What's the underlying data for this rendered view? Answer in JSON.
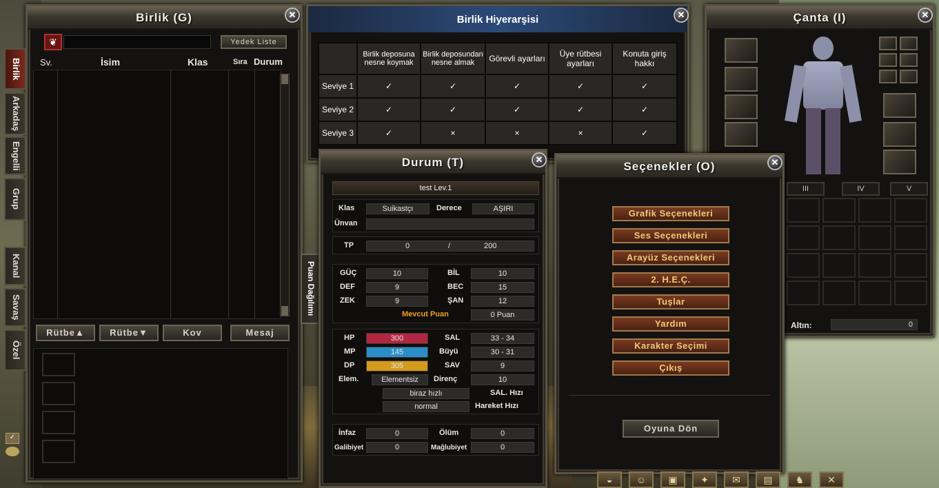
{
  "birlik": {
    "title": "Birlik (G)",
    "reserve_button": "Yedek Liste",
    "columns": [
      "Sv.",
      "İsim",
      "Klas",
      "Sıra",
      "Durum"
    ],
    "buttons": [
      "Rütbe▲",
      "Rütbe▼",
      "Kov",
      "Mesaj"
    ],
    "tabs": [
      "Birlik",
      "Arkadaş",
      "Engelli",
      "Grup",
      "Kanal",
      "Savaş",
      "Özel"
    ]
  },
  "hierarchy": {
    "title": "Birlik Hiyerarşisi",
    "headers": [
      "Birlik deposuna nesne koymak",
      "Birlik deposundan nesne almak",
      "Görevli ayarları",
      "Üye rütbesi ayarları",
      "Konuta giriş hakkı"
    ],
    "rows": [
      {
        "label": "Seviye 1",
        "values": [
          "✓",
          "✓",
          "✓",
          "✓",
          "✓"
        ]
      },
      {
        "label": "Seviye 2",
        "values": [
          "✓",
          "✓",
          "✓",
          "✓",
          "✓"
        ]
      },
      {
        "label": "Seviye 3",
        "values": [
          "✓",
          "×",
          "×",
          "×",
          "✓"
        ]
      }
    ]
  },
  "canta": {
    "title": "Çanta (I)",
    "tabs": [
      "III",
      "IV",
      "V"
    ],
    "gold_label": "Altın:",
    "gold_value": "0"
  },
  "durum": {
    "title": "Durum (T)",
    "name_level": "test Lev.1",
    "klas_label": "Klas",
    "klas_value": "Suikastçı",
    "derece_label": "Derece",
    "derece_value": "AŞIRI",
    "unvan_label": "Ünvan",
    "tp_label": "TP",
    "tp_current": "0",
    "tp_sep": "/",
    "tp_max": "200",
    "stats_left": [
      {
        "label": "GÜÇ",
        "value": "10"
      },
      {
        "label": "DEF",
        "value": "9"
      },
      {
        "label": "ZEK",
        "value": "9"
      }
    ],
    "stats_right": [
      {
        "label": "BİL",
        "value": "10"
      },
      {
        "label": "BEC",
        "value": "15"
      },
      {
        "label": "ŞAN",
        "value": "12"
      }
    ],
    "mevcut_label": "Mevcut Puan",
    "mevcut_value": "0 Puan",
    "hp_label": "HP",
    "hp_value": "300",
    "mp_label": "MP",
    "mp_value": "145",
    "dp_label": "DP",
    "dp_value": "305",
    "elem_label": "Elem.",
    "elem_value": "Elementsiz",
    "sal_label": "SAL",
    "sal_value": "33 - 34",
    "buyu_label": "Büyü",
    "buyu_value": "30 - 31",
    "sav_label": "SAV",
    "sav_value": "9",
    "direnc_label": "Direnç",
    "direnc_value": "10",
    "salhizi_value": "biraz hızlı",
    "salhizi_label": "SAL. Hızı",
    "hareket_value": "normal",
    "hareket_label": "Hareket Hızı",
    "infaz_label": "İnfaz",
    "infaz_value": "0",
    "olum_label": "Ölüm",
    "olum_value": "0",
    "galibiyet_label": "Galibiyet",
    "galibiyet_value": "0",
    "maglubiyet_label": "Mağlubiyet",
    "maglubiyet_value": "0",
    "puan_tab": "Puan Dağılımı"
  },
  "secenekler": {
    "title": "Seçenekler (O)",
    "options": [
      "Grafik Seçenekleri",
      "Ses Seçenekleri",
      "Arayüz Seçenekleri",
      "2. H.E.Ç.",
      "Tuşlar",
      "Yardım",
      "Karakter Seçimi",
      "Çıkış"
    ],
    "back_button": "Oyuna Dön"
  },
  "colors": {
    "hp": "#b3263f",
    "mp": "#2a8fc8",
    "dp": "#d39a1c",
    "ok": "#58e63a",
    "no": "#e33b2b",
    "accent": "#f0c878"
  }
}
